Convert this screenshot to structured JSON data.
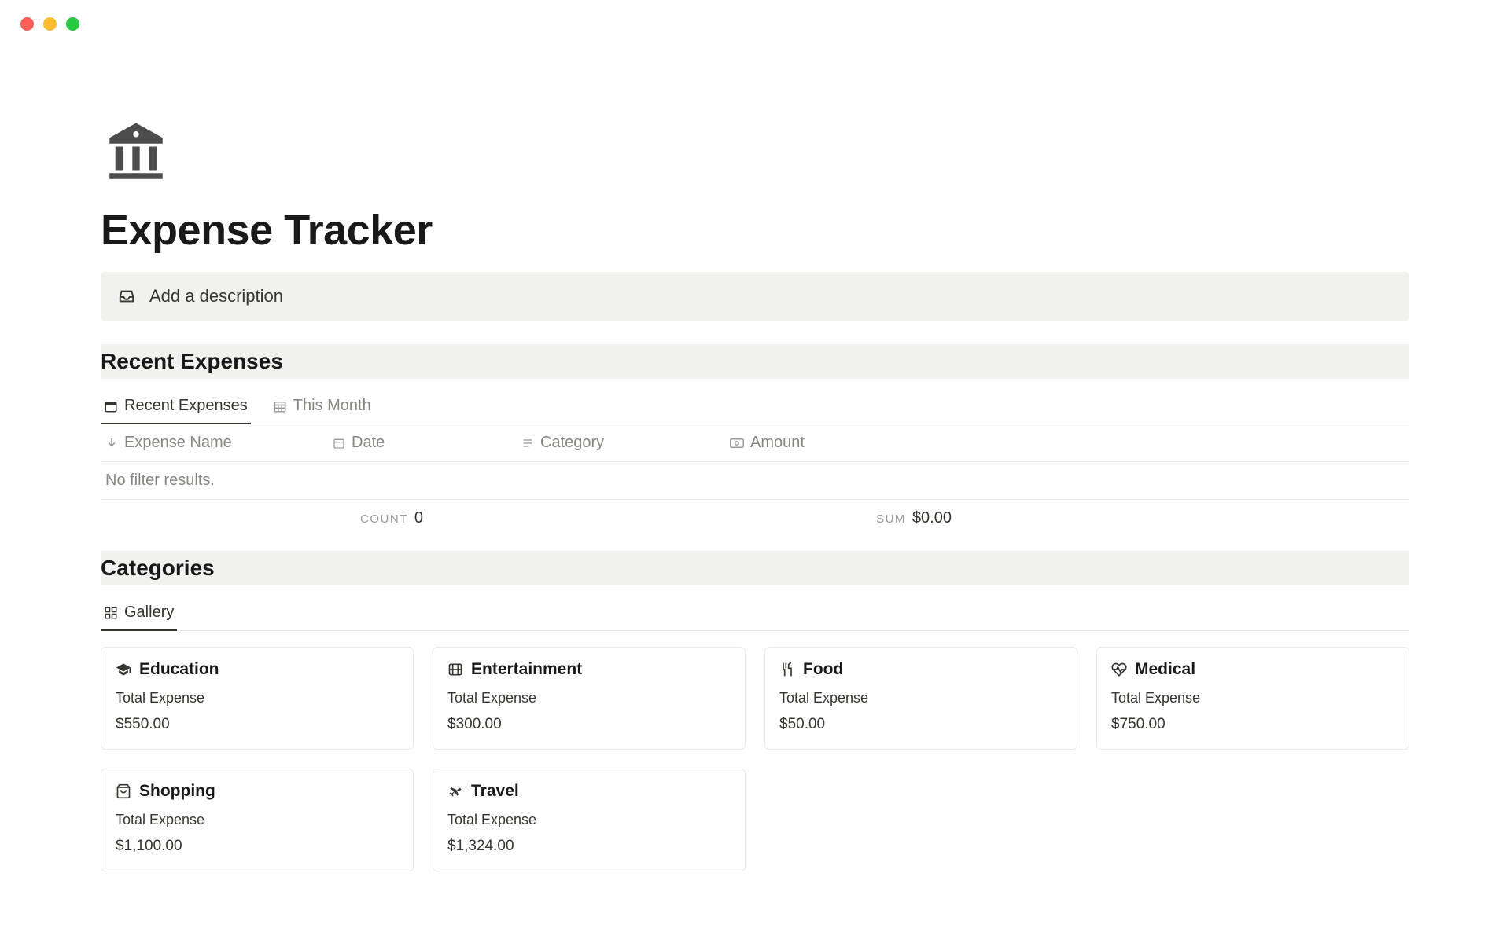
{
  "page": {
    "title": "Expense Tracker",
    "description_placeholder": "Add a description"
  },
  "sections": {
    "recent_expenses": {
      "heading": "Recent Expenses",
      "tabs": [
        "Recent Expenses",
        "This Month"
      ],
      "columns": [
        "Expense Name",
        "Date",
        "Category",
        "Amount"
      ],
      "empty_message": "No filter results.",
      "count_label": "COUNT",
      "count_value": "0",
      "sum_label": "SUM",
      "sum_value": "$0.00"
    },
    "categories": {
      "heading": "Categories",
      "tab": "Gallery",
      "total_label": "Total Expense",
      "cards": [
        {
          "name": "Education",
          "amount": "$550.00",
          "icon": "graduation-cap"
        },
        {
          "name": "Entertainment",
          "amount": "$300.00",
          "icon": "film"
        },
        {
          "name": "Food",
          "amount": "$50.00",
          "icon": "utensils"
        },
        {
          "name": "Medical",
          "amount": "$750.00",
          "icon": "heartbeat"
        },
        {
          "name": "Shopping",
          "amount": "$1,100.00",
          "icon": "shopping-bag"
        },
        {
          "name": "Travel",
          "amount": "$1,324.00",
          "icon": "plane"
        }
      ]
    }
  }
}
